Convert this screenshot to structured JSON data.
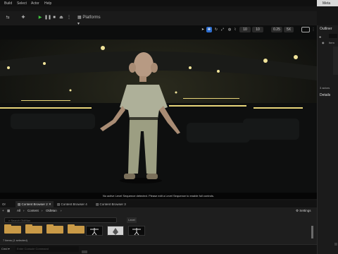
{
  "menu": {
    "items": [
      "Build",
      "Select",
      "Actor",
      "Help"
    ],
    "right_label": "Meta"
  },
  "toolbar": {
    "platforms_label": "Platforms"
  },
  "viewport": {
    "stats": {
      "fov": "5X",
      "speed": "0.25",
      "grid": "10",
      "angle": "10"
    },
    "status_message": "No active Level Sequence detected. Please edit a Level Sequence to enable full controls."
  },
  "outliner": {
    "title": "Outliner",
    "item_label": "Item",
    "actors_count": "3 actors"
  },
  "details": {
    "title": "Details"
  },
  "content_browser": {
    "tabs": [
      "Content Browser 2",
      "Content Browser 4",
      "Content Browser 3"
    ],
    "tab_prefix": "Or",
    "breadcrumb": [
      "All",
      "Content",
      "OldMan"
    ],
    "settings_label": "Settings",
    "search_placeholder": "Search OldMan",
    "items_status": "7 items (1 selected)",
    "level_label": "Level"
  },
  "footer": {
    "cmd_label": "Cmd",
    "console_placeholder": "Enter Console Command"
  }
}
